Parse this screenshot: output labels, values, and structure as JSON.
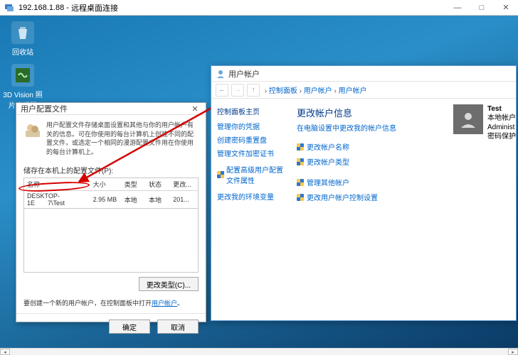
{
  "titlebar": {
    "ip": "192.168.1.88",
    "app": "远程桌面连接"
  },
  "desktop": {
    "recycle": "回收站",
    "nv3d_l1": "3D Vision 照",
    "nv3d_l2": "片查看器"
  },
  "dlg": {
    "title": "用户配置文件",
    "intro": "用户配置文件存储桌面设置和其他与你的用户帐户有关的信息。可在你使用的每台计算机上创建不同的配置文件，或选定一个相同的漫游配置文件用在你使用的每台计算机上。",
    "list_label": "储存在本机上的配置文件(P):",
    "cols": {
      "name": "名称",
      "size": "大小",
      "type": "类型",
      "status": "状态",
      "modified": "更改..."
    },
    "row": {
      "name_pre": "DESKTOP-1E",
      "name_suf": "7\\Test",
      "size": "2.95 MB",
      "type": "本地",
      "status": "本地",
      "modified": "201..."
    },
    "btn_change_type": "更改类型(C)...",
    "hint_pre": "要创建一个新的用户帐户，在控制面板中打开",
    "hint_link": "用户帐户",
    "btn_ok": "确定",
    "btn_cancel": "取消"
  },
  "cp": {
    "win_title": "用户帐户",
    "crumb_root": "控制面板",
    "crumb_mid": "用户帐户",
    "crumb_last": "用户帐户",
    "left": {
      "head": "控制面板主页",
      "l1": "管理你的凭据",
      "l2": "创建密码重置盘",
      "l3": "管理文件加密证书",
      "l4": "配置高级用户配置文件属性",
      "l5": "更改我的环境变量"
    },
    "main": {
      "h": "更改帐户信息",
      "sub": "在电脑设置中更改我的帐户信息",
      "a1": "更改帐户名称",
      "a2": "更改帐户类型",
      "a3": "管理其他帐户",
      "a4": "更改用户帐户控制设置"
    },
    "user": {
      "name": "Test",
      "role": "本地帐户",
      "admin": "Administ",
      "pw": "密码保护"
    }
  }
}
